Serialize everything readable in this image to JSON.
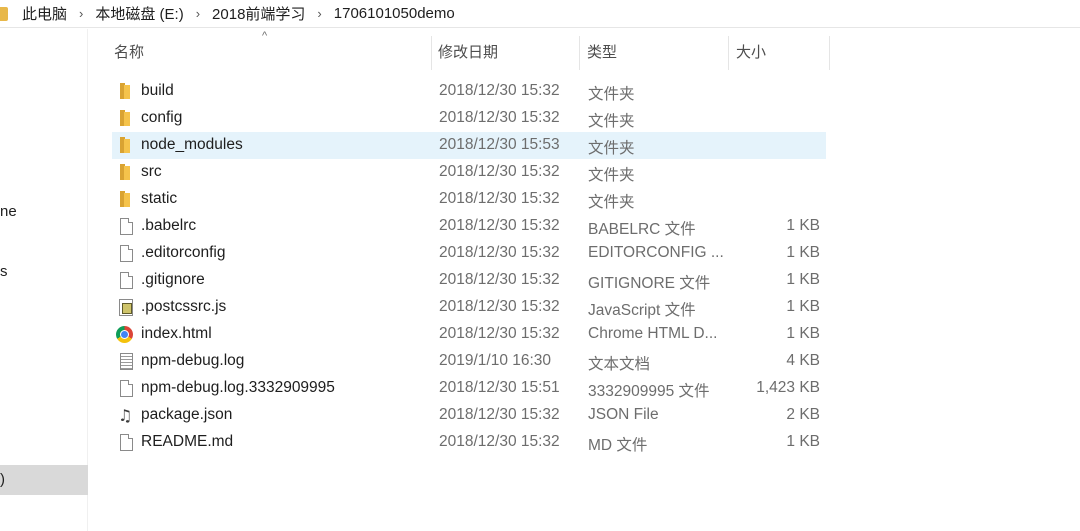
{
  "breadcrumb": [
    "此电脑",
    "本地磁盘 (E:)",
    "2018前端学习",
    "1706101050demo"
  ],
  "nav": {
    "partial_items": [
      "ne",
      "s"
    ],
    "selected_partial": ")"
  },
  "columns": {
    "name": "名称",
    "date": "修改日期",
    "type": "类型",
    "size": "大小",
    "sort_indicator": "^"
  },
  "files": [
    {
      "name": "build",
      "date": "2018/12/30 15:32",
      "type": "文件夹",
      "size": "",
      "icon": "folder-icon",
      "selected": false
    },
    {
      "name": "config",
      "date": "2018/12/30 15:32",
      "type": "文件夹",
      "size": "",
      "icon": "folder-icon",
      "selected": false
    },
    {
      "name": "node_modules",
      "date": "2018/12/30 15:53",
      "type": "文件夹",
      "size": "",
      "icon": "folder-icon",
      "selected": true
    },
    {
      "name": "src",
      "date": "2018/12/30 15:32",
      "type": "文件夹",
      "size": "",
      "icon": "folder-icon",
      "selected": false
    },
    {
      "name": "static",
      "date": "2018/12/30 15:32",
      "type": "文件夹",
      "size": "",
      "icon": "folder-icon",
      "selected": false
    },
    {
      "name": ".babelrc",
      "date": "2018/12/30 15:32",
      "type": "BABELRC 文件",
      "size": "1 KB",
      "icon": "file-icon",
      "selected": false
    },
    {
      "name": ".editorconfig",
      "date": "2018/12/30 15:32",
      "type": "EDITORCONFIG ...",
      "size": "1 KB",
      "icon": "file-icon",
      "selected": false
    },
    {
      "name": ".gitignore",
      "date": "2018/12/30 15:32",
      "type": "GITIGNORE 文件",
      "size": "1 KB",
      "icon": "file-icon",
      "selected": false
    },
    {
      "name": ".postcssrc.js",
      "date": "2018/12/30 15:32",
      "type": "JavaScript 文件",
      "size": "1 KB",
      "icon": "javascript-file-icon",
      "selected": false
    },
    {
      "name": "index.html",
      "date": "2018/12/30 15:32",
      "type": "Chrome HTML D...",
      "size": "1 KB",
      "icon": "chrome-icon",
      "selected": false
    },
    {
      "name": "npm-debug.log",
      "date": "2019/1/10 16:30",
      "type": "文本文档",
      "size": "4 KB",
      "icon": "text-document-icon",
      "selected": false
    },
    {
      "name": "npm-debug.log.3332909995",
      "date": "2018/12/30 15:51",
      "type": "3332909995 文件",
      "size": "1,423 KB",
      "icon": "file-icon",
      "selected": false
    },
    {
      "name": "package.json",
      "date": "2018/12/30 15:32",
      "type": "JSON File",
      "size": "2 KB",
      "icon": "json-file-icon",
      "selected": false
    },
    {
      "name": "README.md",
      "date": "2018/12/30 15:32",
      "type": "MD 文件",
      "size": "1 KB",
      "icon": "file-icon",
      "selected": false
    }
  ],
  "colors": {
    "selection": "#e5f3fb",
    "nav_selection": "#d9d9d9",
    "folder": "#f5c34b",
    "muted_text": "#6d6d6d"
  }
}
